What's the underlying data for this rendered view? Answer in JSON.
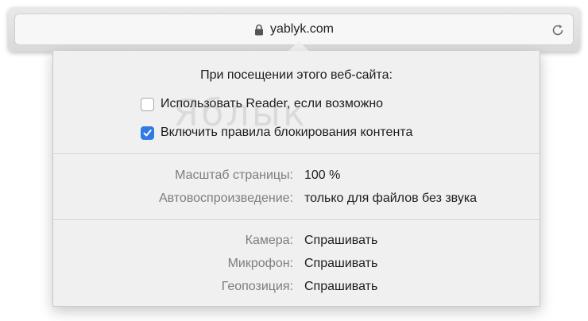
{
  "address_bar": {
    "url": "yablyk.com",
    "lock_icon": "lock-icon",
    "reload_icon": "reload-icon"
  },
  "popover": {
    "title": "При посещении этого веб-сайта:",
    "options": [
      {
        "label": "Использовать Reader, если возможно",
        "checked": false
      },
      {
        "label": "Включить правила блокирования контента",
        "checked": true
      }
    ],
    "settings_group_1": [
      {
        "label": "Масштаб страницы:",
        "value": "100 %"
      },
      {
        "label": "Автовоспроизведение:",
        "value": "только для файлов без звука"
      }
    ],
    "settings_group_2": [
      {
        "label": "Камера:",
        "value": "Спрашивать"
      },
      {
        "label": "Микрофон:",
        "value": "Спрашивать"
      },
      {
        "label": "Геопозиция:",
        "value": "Спрашивать"
      }
    ]
  },
  "watermark": "Яблык",
  "colors": {
    "checkbox_accent": "#2f7ae5",
    "label_gray": "#7d7d7d",
    "popover_bg": "#f0f0f0"
  }
}
